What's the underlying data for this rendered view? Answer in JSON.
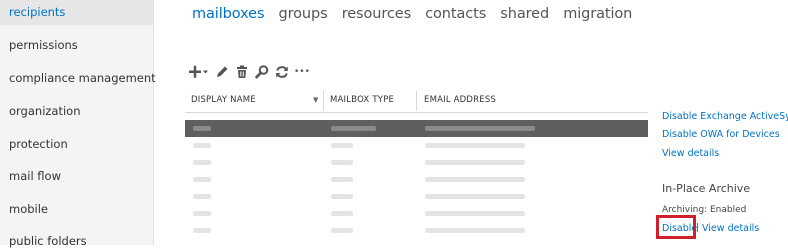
{
  "sidebar": {
    "items": [
      {
        "label": "recipients",
        "active": true
      },
      {
        "label": "permissions"
      },
      {
        "label": "compliance management"
      },
      {
        "label": "organization"
      },
      {
        "label": "protection"
      },
      {
        "label": "mail flow"
      },
      {
        "label": "mobile"
      },
      {
        "label": "public folders"
      }
    ]
  },
  "tabs": [
    {
      "label": "mailboxes",
      "active": true
    },
    {
      "label": "groups"
    },
    {
      "label": "resources"
    },
    {
      "label": "contacts"
    },
    {
      "label": "shared"
    },
    {
      "label": "migration"
    }
  ],
  "toolbar": {
    "icons": [
      "add-icon",
      "edit-icon",
      "delete-icon",
      "search-icon",
      "refresh-icon",
      "more-icon"
    ],
    "more_label": "•••"
  },
  "table": {
    "columns": [
      "DISPLAY NAME",
      "MAILBOX TYPE",
      "EMAIL ADDRESS"
    ],
    "selected_row": 0
  },
  "details": {
    "disable_activesync": "Disable Exchange ActiveSync",
    "disable_owa": "Disable OWA for Devices",
    "view_details_1": "View details",
    "archive_heading": "In-Place Archive",
    "archiving_label": "Archiving:",
    "archiving_status": "Enabled",
    "disable_link": "Disable",
    "separator": "|",
    "view_details_2": "View details"
  },
  "colors": {
    "accent": "#0072c6",
    "highlight": "#d0202a",
    "selected_row": "#5f5f5f"
  }
}
